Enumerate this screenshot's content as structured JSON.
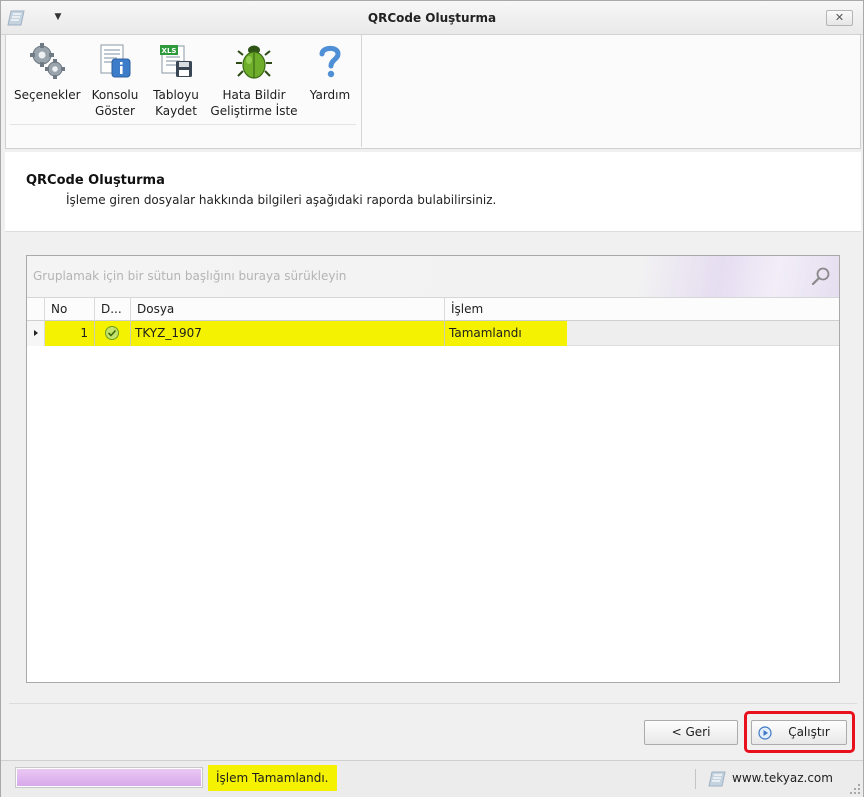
{
  "window": {
    "title": "QRCode Oluşturma",
    "close_label": "✕"
  },
  "ribbon": {
    "buttons": [
      {
        "label1": "Seçenekler",
        "label2": "",
        "icon": "gears-icon"
      },
      {
        "label1": "Konsolu",
        "label2": "Göster",
        "icon": "console-info-icon"
      },
      {
        "label1": "Tabloyu",
        "label2": "Kaydet",
        "icon": "xls-save-icon"
      },
      {
        "label1": "Hata Bildir",
        "label2": "Geliştirme İste",
        "icon": "bug-icon"
      },
      {
        "label1": "Yardım",
        "label2": "",
        "icon": "help-icon"
      }
    ]
  },
  "header": {
    "title": "QRCode Oluşturma",
    "description": "İşleme giren dosyalar hakkında bilgileri aşağıdaki raporda bulabilirsiniz."
  },
  "grid": {
    "group_hint": "Gruplamak için bir sütun başlığını buraya sürükleyin",
    "columns": [
      "No",
      "D...",
      "Dosya",
      "İşlem"
    ],
    "rows": [
      {
        "no": "1",
        "status_icon": "check-icon",
        "dosya": "TKYZ_1907",
        "islem": "Tamamlandı"
      }
    ]
  },
  "buttons": {
    "back": "< Geri",
    "run": "Çalıştır"
  },
  "status": {
    "progress_fraction": 1.0,
    "message": "İşlem Tamamlandı.",
    "site": "www.tekyaz.com"
  },
  "colors": {
    "highlight": "#f4f200",
    "run_outline": "#e8101c",
    "progress": "#dcb1ee"
  }
}
